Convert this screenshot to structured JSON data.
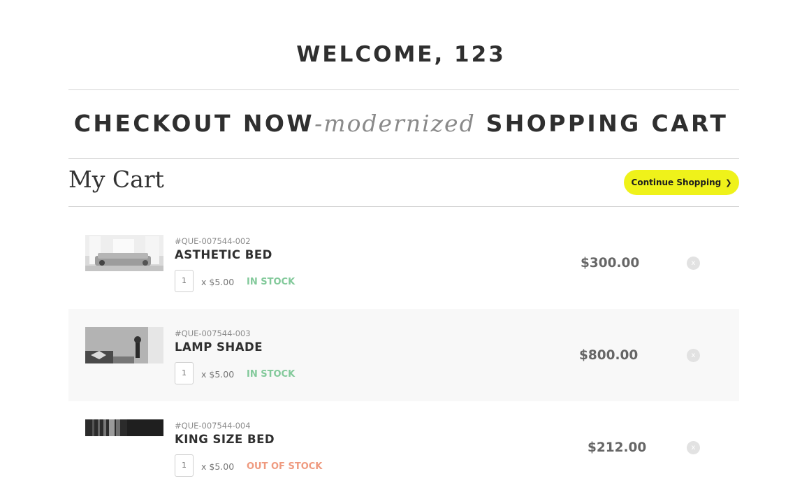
{
  "header": {
    "welcome": "WELCOME, 123",
    "headline_part1": "CHECKOUT NOW",
    "headline_italic": "-modernized",
    "headline_part2": " SHOPPING CART"
  },
  "cart": {
    "title": "My Cart",
    "continue_label": "Continue Shopping",
    "continue_icon": "chevron-right-icon",
    "items": [
      {
        "sku": "#QUE-007544-002",
        "name": "ASTHETIC BED",
        "qty": "1",
        "unit_price": "x $5.00",
        "stock": "IN STOCK",
        "price": "$300.00",
        "remove": "x"
      },
      {
        "sku": "#QUE-007544-003",
        "name": "LAMP SHADE",
        "qty": "1",
        "unit_price": "x $5.00",
        "stock": "IN STOCK",
        "price": "$800.00",
        "remove": "x"
      },
      {
        "sku": "#QUE-007544-004",
        "name": "KING SIZE BED",
        "qty": "1",
        "unit_price": "x $5.00",
        "stock": "OUT OF STOCK",
        "price": "$212.00",
        "remove": "x"
      }
    ]
  },
  "colors": {
    "accent": "#eff21a",
    "in_stock": "#82c99a",
    "out_of_stock": "#ef9a7f",
    "row_alt_bg": "#f8f8f8"
  }
}
